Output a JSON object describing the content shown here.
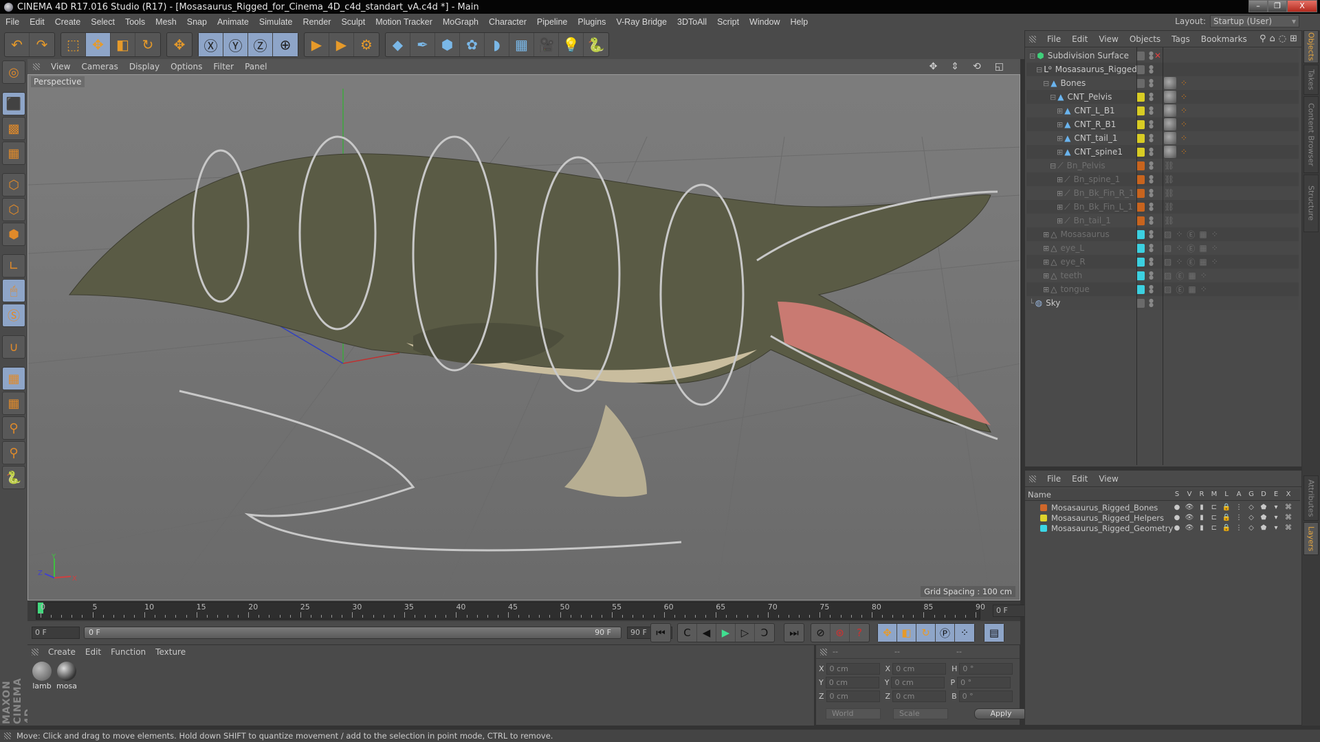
{
  "window": {
    "title": "CINEMA 4D R17.016 Studio (R17) - [Mosasaurus_Rigged_for_Cinema_4D_c4d_standart_vA.c4d *] - Main",
    "buttons": {
      "minimize": "–",
      "restore": "❐",
      "close": "X"
    }
  },
  "menubar": {
    "items": [
      "File",
      "Edit",
      "Create",
      "Select",
      "Tools",
      "Mesh",
      "Snap",
      "Animate",
      "Simulate",
      "Render",
      "Sculpt",
      "Motion Tracker",
      "MoGraph",
      "Character",
      "Pipeline",
      "Plugins",
      "V-Ray Bridge",
      "3DToAll",
      "Script",
      "Window",
      "Help"
    ],
    "layout_label": "Layout:",
    "layout_value": "Startup (User)"
  },
  "toolbar": {
    "groups": [
      [
        {
          "icon": "undo-icon",
          "glyph": "↶",
          "on": false
        },
        {
          "icon": "redo-icon",
          "glyph": "↷",
          "on": false
        }
      ],
      [
        {
          "icon": "live-selection-icon",
          "glyph": "⬚",
          "on": false
        },
        {
          "icon": "move-icon",
          "glyph": "✥",
          "on": true
        },
        {
          "icon": "scale-icon",
          "glyph": "◧",
          "on": false
        },
        {
          "icon": "rotate-icon",
          "glyph": "↻",
          "on": false
        }
      ],
      [
        {
          "icon": "recent-tool-icon",
          "glyph": "✥",
          "on": false
        }
      ],
      [
        {
          "icon": "x-axis-icon",
          "glyph": "Ⓧ",
          "on": true
        },
        {
          "icon": "y-axis-icon",
          "glyph": "Ⓨ",
          "on": true
        },
        {
          "icon": "z-axis-icon",
          "glyph": "Ⓩ",
          "on": true
        },
        {
          "icon": "coordinate-system-icon",
          "glyph": "⊕",
          "on": true
        }
      ],
      [
        {
          "icon": "render-view-icon",
          "glyph": "▶",
          "on": false
        },
        {
          "icon": "render-picture-viewer-icon",
          "glyph": "▶",
          "on": false
        },
        {
          "icon": "render-settings-icon",
          "glyph": "⚙",
          "on": false
        }
      ],
      [
        {
          "icon": "cube-icon",
          "glyph": "◆",
          "on": false
        },
        {
          "icon": "pen-icon",
          "glyph": "✒",
          "on": false
        },
        {
          "icon": "subdivision-icon",
          "glyph": "⬢",
          "on": false
        },
        {
          "icon": "cloner-icon",
          "glyph": "✿",
          "on": false
        },
        {
          "icon": "deformer-icon",
          "glyph": "◗",
          "on": false
        },
        {
          "icon": "floor-icon",
          "glyph": "▦",
          "on": false
        },
        {
          "icon": "camera-icon",
          "glyph": "🎥",
          "on": false
        },
        {
          "icon": "light-icon",
          "glyph": "💡",
          "on": false
        },
        {
          "icon": "python-icon",
          "glyph": "🐍",
          "on": false
        }
      ]
    ]
  },
  "left_tools": [
    {
      "icon": "make-editable-icon",
      "glyph": "◎",
      "on": false
    },
    {
      "icon": "model-mode-icon",
      "glyph": "⬛",
      "on": true
    },
    {
      "icon": "texture-mode-icon",
      "glyph": "▩",
      "on": false
    },
    {
      "icon": "workplane-mode-icon",
      "glyph": "▦",
      "on": false
    },
    {
      "icon": "points-mode-icon",
      "glyph": "⬡",
      "on": false
    },
    {
      "icon": "edges-mode-icon",
      "glyph": "⬡",
      "on": false
    },
    {
      "icon": "polygons-mode-icon",
      "glyph": "⬢",
      "on": false
    },
    {
      "icon": "axis-mode-icon",
      "glyph": "∟",
      "on": false
    },
    {
      "icon": "tweak-mode-icon",
      "glyph": "🖱",
      "on": true
    },
    {
      "icon": "solo-mode-icon",
      "glyph": "Ⓢ",
      "on": true
    },
    {
      "icon": "snap-icon",
      "glyph": "∪",
      "on": false
    },
    {
      "icon": "workplane-lock-icon",
      "glyph": "▦",
      "on": true
    },
    {
      "icon": "workplane-align-icon",
      "glyph": "▦",
      "on": false
    },
    {
      "icon": "sculpt-brush-icon",
      "glyph": "⚲",
      "on": false
    },
    {
      "icon": "sculpt-paint-icon",
      "glyph": "⚲",
      "on": false
    },
    {
      "icon": "python-script-icon",
      "glyph": "🐍",
      "on": false
    }
  ],
  "brand": "MAXON CINEMA 4D",
  "viewport": {
    "menu": [
      "View",
      "Cameras",
      "Display",
      "Options",
      "Filter",
      "Panel"
    ],
    "camera_label": "Perspective",
    "grid_spacing": "Grid Spacing : 100 cm",
    "axis_labels": {
      "x": "X",
      "y": "Y",
      "z": "Z"
    }
  },
  "timeline": {
    "ticks": [
      "0",
      "5",
      "10",
      "15",
      "20",
      "25",
      "30",
      "35",
      "40",
      "45",
      "50",
      "55",
      "60",
      "65",
      "70",
      "75",
      "80",
      "85",
      "90"
    ],
    "current_frame": "0 F",
    "start_field": "0 F",
    "slider_start": "0 F",
    "slider_end": "90 F",
    "end_field": "90 F",
    "max_frame": 90
  },
  "playback": {
    "buttons": [
      {
        "icon": "go-to-start-icon",
        "glyph": "⏮"
      },
      {
        "icon": "previous-key-icon",
        "glyph": "C"
      },
      {
        "icon": "previous-frame-icon",
        "glyph": "◀"
      },
      {
        "icon": "play-icon",
        "glyph": "▶"
      },
      {
        "icon": "next-frame-icon",
        "glyph": "▷"
      },
      {
        "icon": "next-key-icon",
        "glyph": "Ɔ"
      },
      {
        "icon": "go-to-end-icon",
        "glyph": "⏭"
      },
      {
        "icon": "motion-path-icon",
        "glyph": "⊘"
      },
      {
        "icon": "record-keys-icon",
        "glyph": "⊛"
      },
      {
        "icon": "autokey-icon",
        "glyph": "?"
      },
      {
        "icon": "key-position-icon",
        "glyph": "✥"
      },
      {
        "icon": "key-scale-icon",
        "glyph": "◧"
      },
      {
        "icon": "key-rotation-icon",
        "glyph": "↻"
      },
      {
        "icon": "key-param-icon",
        "glyph": "Ⓟ"
      },
      {
        "icon": "key-pla-icon",
        "glyph": "⁘"
      },
      {
        "icon": "timeline-window-icon",
        "glyph": "▤"
      }
    ]
  },
  "material_manager": {
    "menu": [
      "Create",
      "Edit",
      "Function",
      "Texture"
    ],
    "materials": [
      {
        "name": "lamb"
      },
      {
        "name": "mosa"
      }
    ]
  },
  "coordinates": {
    "headers": [
      "--",
      "--",
      "--"
    ],
    "rows": [
      {
        "l1": "X",
        "v1": "0 cm",
        "l2": "X",
        "v2": "0 cm",
        "l3": "H",
        "v3": "0 °"
      },
      {
        "l1": "Y",
        "v1": "0 cm",
        "l2": "Y",
        "v2": "0 cm",
        "l3": "P",
        "v3": "0 °"
      },
      {
        "l1": "Z",
        "v1": "0 cm",
        "l2": "Z",
        "v2": "0 cm",
        "l3": "B",
        "v3": "0 °"
      }
    ],
    "space": "World",
    "mode": "Scale",
    "apply": "Apply"
  },
  "object_manager": {
    "menu": [
      "File",
      "Edit",
      "View",
      "Objects",
      "Tags",
      "Bookmarks"
    ],
    "objects": [
      {
        "name": "Subdivision Surface",
        "depth": 0,
        "icon": "subdivision-surface-icon",
        "glyph": "⬢",
        "icolor": "#3fd07a",
        "swatch": "none",
        "tags": "",
        "dim": false,
        "x": true
      },
      {
        "name": "Mosasaurus_Rigged",
        "depth": 1,
        "icon": "null-object-icon",
        "glyph": "L⁰",
        "icolor": "#ddd",
        "swatch": "none",
        "tags": "",
        "dim": false
      },
      {
        "name": "Bones",
        "depth": 2,
        "icon": "joint-icon",
        "glyph": "▲",
        "icolor": "#6ab4ee",
        "swatch": "none",
        "tags": "skin",
        "dim": false
      },
      {
        "name": "CNT_Pelvis",
        "depth": 3,
        "icon": "joint-icon",
        "glyph": "▲",
        "icolor": "#6ab4ee",
        "swatch": "#d8cc24",
        "tags": "skin",
        "dim": false
      },
      {
        "name": "CNT_L_B1",
        "depth": 4,
        "icon": "joint-icon",
        "glyph": "▲",
        "icolor": "#6ab4ee",
        "swatch": "#d8cc24",
        "tags": "skin",
        "dim": false
      },
      {
        "name": "CNT_R_B1",
        "depth": 4,
        "icon": "joint-icon",
        "glyph": "▲",
        "icolor": "#6ab4ee",
        "swatch": "#d8cc24",
        "tags": "skin",
        "dim": false
      },
      {
        "name": "CNT_tail_1",
        "depth": 4,
        "icon": "joint-icon",
        "glyph": "▲",
        "icolor": "#6ab4ee",
        "swatch": "#d8cc24",
        "tags": "skin",
        "dim": false
      },
      {
        "name": "CNT_spine1",
        "depth": 4,
        "icon": "joint-icon",
        "glyph": "▲",
        "icolor": "#6ab4ee",
        "swatch": "#d8cc24",
        "tags": "skin",
        "dim": false
      },
      {
        "name": "Bn_Pelvis",
        "depth": 3,
        "icon": "bone-icon",
        "glyph": "⟋",
        "icolor": "#777",
        "swatch": "#c8641e",
        "tags": "ik",
        "dim": true
      },
      {
        "name": "Bn_spine_1",
        "depth": 4,
        "icon": "bone-icon",
        "glyph": "⟋",
        "icolor": "#777",
        "swatch": "#c8641e",
        "tags": "ik",
        "dim": true
      },
      {
        "name": "Bn_Bk_Fin_R_1",
        "depth": 4,
        "icon": "bone-icon",
        "glyph": "⟋",
        "icolor": "#777",
        "swatch": "#c8641e",
        "tags": "ik",
        "dim": true
      },
      {
        "name": "Bn_Bk_Fin_L_1",
        "depth": 4,
        "icon": "bone-icon",
        "glyph": "⟋",
        "icolor": "#777",
        "swatch": "#c8641e",
        "tags": "ik",
        "dim": true
      },
      {
        "name": "Bn_tail_1",
        "depth": 4,
        "icon": "bone-icon",
        "glyph": "⟋",
        "icolor": "#777",
        "swatch": "#c8641e",
        "tags": "ik",
        "dim": true
      },
      {
        "name": "Mosasaurus",
        "depth": 2,
        "icon": "polygon-object-icon",
        "glyph": "△",
        "icolor": "#888",
        "swatch": "#3cd0e0",
        "tags": "mesh",
        "dim": true
      },
      {
        "name": "eye_L",
        "depth": 2,
        "icon": "polygon-object-icon",
        "glyph": "△",
        "icolor": "#888",
        "swatch": "#3cd0e0",
        "tags": "mesh",
        "dim": true
      },
      {
        "name": "eye_R",
        "depth": 2,
        "icon": "polygon-object-icon",
        "glyph": "△",
        "icolor": "#888",
        "swatch": "#3cd0e0",
        "tags": "mesh",
        "dim": true
      },
      {
        "name": "teeth",
        "depth": 2,
        "icon": "polygon-object-icon",
        "glyph": "△",
        "icolor": "#888",
        "swatch": "#3cd0e0",
        "tags": "mesh2",
        "dim": true
      },
      {
        "name": "tongue",
        "depth": 2,
        "icon": "polygon-object-icon",
        "glyph": "△",
        "icolor": "#888",
        "swatch": "#3cd0e0",
        "tags": "mesh2",
        "dim": true
      },
      {
        "name": "Sky",
        "depth": 0,
        "icon": "sky-icon",
        "glyph": "◍",
        "icolor": "#9ab8e0",
        "swatch": "none",
        "tags": "",
        "dim": false
      }
    ]
  },
  "layer_manager": {
    "menu": [
      "File",
      "Edit",
      "View"
    ],
    "columns": [
      "Name",
      "S",
      "V",
      "R",
      "M",
      "L",
      "A",
      "G",
      "D",
      "E",
      "X"
    ],
    "layers": [
      {
        "name": "Mosasaurus_Rigged_Bones",
        "color": "#d0672a"
      },
      {
        "name": "Mosasaurus_Rigged_Helpers",
        "color": "#ddd32c"
      },
      {
        "name": "Mosasaurus_Rigged_Geometry",
        "color": "#3cd6e6"
      }
    ]
  },
  "side_tabs": {
    "top": [
      {
        "label": "Objects",
        "active": true
      },
      {
        "label": "Takes",
        "active": false
      },
      {
        "label": "Content Browser",
        "active": false
      },
      {
        "label": "Structure",
        "active": false
      }
    ],
    "bottom": [
      {
        "label": "Attributes",
        "active": false
      },
      {
        "label": "Layers",
        "active": true
      }
    ]
  },
  "status_bar": "Move: Click and drag to move elements. Hold down SHIFT to quantize movement / add to the selection in point mode, CTRL to remove.",
  "colors": {
    "accent_blue": "#8ea5c8",
    "playhead": "#43d97e",
    "active_tab": "#e6a640"
  }
}
